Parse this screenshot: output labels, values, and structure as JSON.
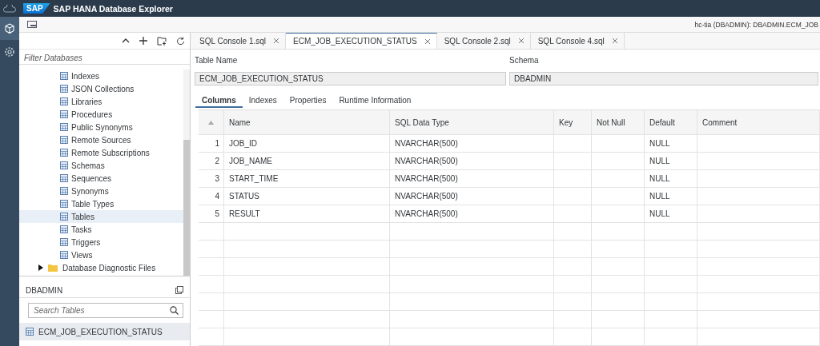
{
  "app": {
    "title": "SAP HANA Database Explorer",
    "logo": "SAP"
  },
  "toolbar": {
    "connection": "hc-tia (DBADMIN): DBADMIN.ECM_JOB"
  },
  "catalog": {
    "filter_placeholder": "Filter Databases",
    "items": [
      {
        "label": "Indexes",
        "kind": "object",
        "selected": false
      },
      {
        "label": "JSON Collections",
        "kind": "object",
        "selected": false
      },
      {
        "label": "Libraries",
        "kind": "object",
        "selected": false
      },
      {
        "label": "Procedures",
        "kind": "object",
        "selected": false
      },
      {
        "label": "Public Synonyms",
        "kind": "object",
        "selected": false
      },
      {
        "label": "Remote Sources",
        "kind": "object",
        "selected": false
      },
      {
        "label": "Remote Subscriptions",
        "kind": "object",
        "selected": false
      },
      {
        "label": "Schemas",
        "kind": "object",
        "selected": false
      },
      {
        "label": "Sequences",
        "kind": "object",
        "selected": false
      },
      {
        "label": "Synonyms",
        "kind": "object",
        "selected": false
      },
      {
        "label": "Table Types",
        "kind": "object",
        "selected": false
      },
      {
        "label": "Tables",
        "kind": "object",
        "selected": true
      },
      {
        "label": "Tasks",
        "kind": "object",
        "selected": false
      },
      {
        "label": "Triggers",
        "kind": "object",
        "selected": false
      },
      {
        "label": "Views",
        "kind": "object",
        "selected": false
      },
      {
        "label": "Database Diagnostic Files",
        "kind": "folder",
        "expanded": false,
        "selected": false
      }
    ]
  },
  "object_list": {
    "title": "DBADMIN",
    "search_placeholder": "Search Tables",
    "items": [
      {
        "label": "ECM_JOB_EXECUTION_STATUS",
        "selected": true
      }
    ]
  },
  "tabs": [
    {
      "label": "SQL Console 1.sql",
      "selected": false
    },
    {
      "label": "ECM_JOB_EXECUTION_STATUS",
      "selected": true
    },
    {
      "label": "SQL Console 2.sql",
      "selected": false
    },
    {
      "label": "SQL Console 4.sql",
      "selected": false
    }
  ],
  "form": {
    "table_name_label": "Table Name",
    "table_name": "ECM_JOB_EXECUTION_STATUS",
    "schema_label": "Schema",
    "schema": "DBADMIN"
  },
  "subtabs": [
    {
      "label": "Columns",
      "selected": true
    },
    {
      "label": "Indexes",
      "selected": false
    },
    {
      "label": "Properties",
      "selected": false
    },
    {
      "label": "Runtime Information",
      "selected": false
    }
  ],
  "table": {
    "columns": [
      "Name",
      "SQL Data Type",
      "Key",
      "Not Null",
      "Default",
      "Comment"
    ],
    "rows": [
      {
        "index": "1",
        "cells": [
          "JOB_ID",
          "NVARCHAR(500)",
          "",
          "",
          "NULL",
          ""
        ]
      },
      {
        "index": "2",
        "cells": [
          "JOB_NAME",
          "NVARCHAR(500)",
          "",
          "",
          "NULL",
          ""
        ]
      },
      {
        "index": "3",
        "cells": [
          "START_TIME",
          "NVARCHAR(500)",
          "",
          "",
          "NULL",
          ""
        ]
      },
      {
        "index": "4",
        "cells": [
          "STATUS",
          "NVARCHAR(500)",
          "",
          "",
          "NULL",
          ""
        ]
      },
      {
        "index": "5",
        "cells": [
          "RESULT",
          "NVARCHAR(500)",
          "",
          "",
          "NULL",
          ""
        ]
      }
    ]
  }
}
